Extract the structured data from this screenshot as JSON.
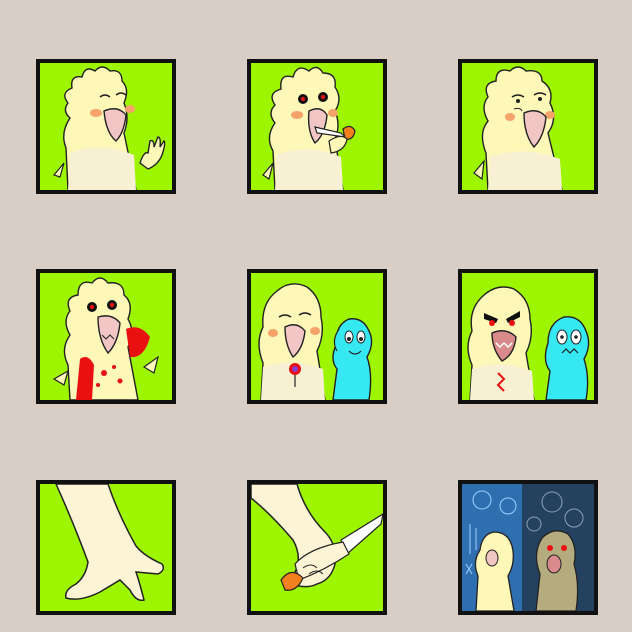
{
  "colors": {
    "background": "#d9cec6",
    "panel_border": "#111111",
    "panel_green": "#9ef500",
    "bird_body": "#fdf7b8",
    "bird_lower": "#f7f0d2",
    "cheek": "#f5a36a",
    "beak": "#f3c6c6",
    "blood": "#e81010",
    "blue_creature": "#35e8f2",
    "knife_handle": "#f2801c",
    "dark_panel": "#24425f"
  },
  "panels": [
    {
      "icon": "happy-bird-waving"
    },
    {
      "icon": "bird-holding-knife"
    },
    {
      "icon": "sad-bird"
    },
    {
      "icon": "bloody-bird"
    },
    {
      "icon": "bird-with-flower-and-blue-friend"
    },
    {
      "icon": "angry-bird-with-scared-blue-friend"
    },
    {
      "icon": "bird-foot-closeup"
    },
    {
      "icon": "bird-foot-with-knife"
    },
    {
      "icon": "dark-scene-with-faces"
    }
  ]
}
